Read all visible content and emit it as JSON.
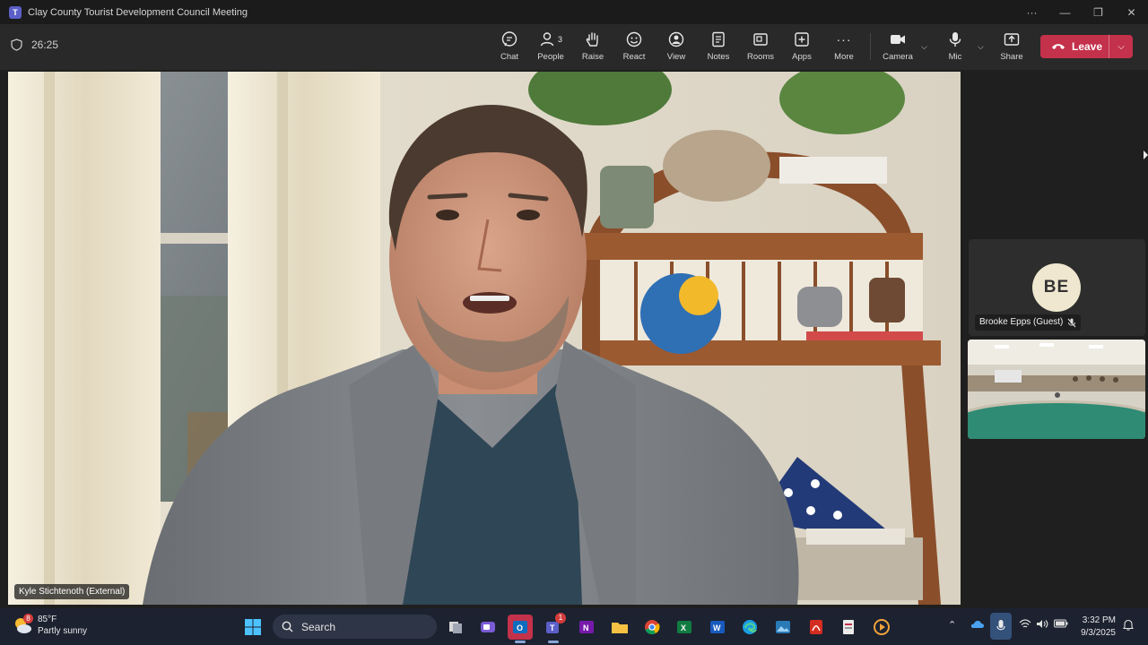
{
  "window": {
    "title": "Clay County Tourist Development Council Meeting"
  },
  "meeting": {
    "timer": "26:25",
    "toolbar": {
      "chat": "Chat",
      "people": "People",
      "people_count": "3",
      "raise": "Raise",
      "react": "React",
      "view": "View",
      "notes": "Notes",
      "rooms": "Rooms",
      "apps": "Apps",
      "more": "More",
      "camera": "Camera",
      "mic": "Mic",
      "share": "Share",
      "leave": "Leave"
    },
    "main_speaker": {
      "name": "Kyle Stichtenoth (External)"
    },
    "participants": [
      {
        "initials": "BE",
        "name": "Brooke Epps (Guest)",
        "muted": true
      }
    ]
  },
  "taskbar": {
    "weather": {
      "temp": "85°F",
      "condition": "Partly sunny",
      "badge": "8"
    },
    "search_label": "Search",
    "teams_badge": "1",
    "clock": {
      "time": "3:32 PM",
      "date": "9/3/2025"
    }
  },
  "colors": {
    "leave_red": "#c4314b",
    "teams_purple": "#5b5fc7",
    "taskbar": "#1c2230"
  }
}
